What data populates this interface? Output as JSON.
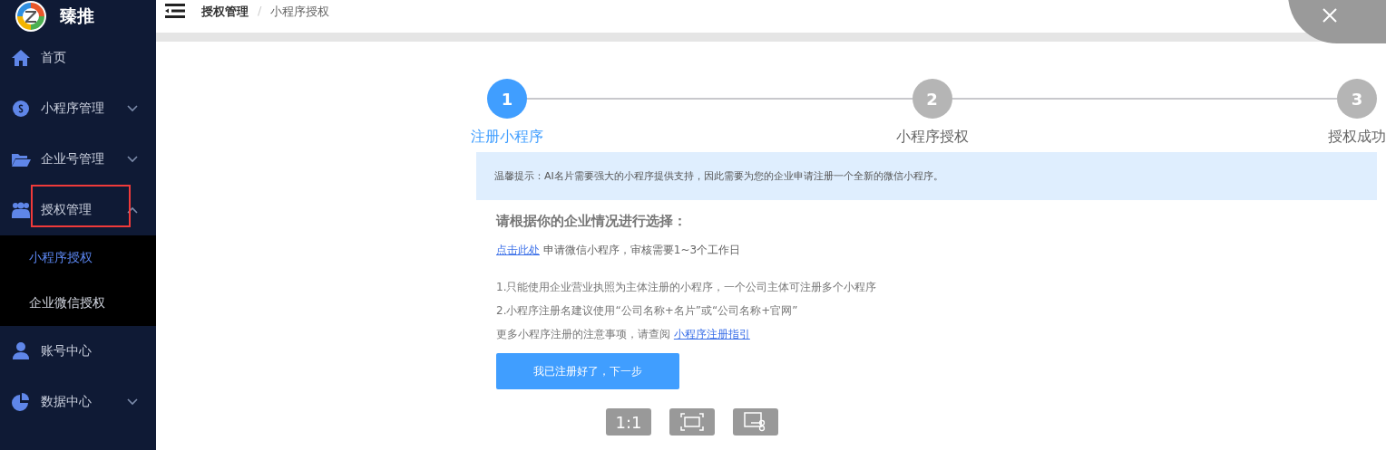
{
  "sidebar": {
    "logo_text": "臻推",
    "items": [
      {
        "label": "首页",
        "highlighted": false
      },
      {
        "label": "小程序管理",
        "expanded": false,
        "highlighted": false
      },
      {
        "label": "企业号管理",
        "expanded": false,
        "highlighted": false
      },
      {
        "label": "授权管理",
        "expanded": true,
        "highlighted": true,
        "children": [
          {
            "label": "小程序授权",
            "selected": true
          },
          {
            "label": "企业微信授权",
            "selected": false
          }
        ]
      },
      {
        "label": "账号中心",
        "highlighted": false
      },
      {
        "label": "数据中心",
        "expanded": false,
        "highlighted": false
      }
    ]
  },
  "breadcrumb": [
    "授权管理",
    "/",
    "小程序授权"
  ],
  "steps": [
    {
      "number": "1",
      "label": "注册小程序",
      "active": true
    },
    {
      "number": "2",
      "label": "小程序授权",
      "active": false
    },
    {
      "number": "3",
      "label": "授权成功",
      "active": false
    }
  ],
  "tip": "温馨提示：AI名片需要强大的小程序提供支持，因此需要为您的企业申请注册一个全新的微信小程序。",
  "heading": "请根据你的企业情况进行选择：",
  "apply_link": "点击此处",
  "apply_text": "申请微信小程序，审核需要1~3个工作日",
  "notes": [
    "1.只能使用企业营业执照为主体注册的小程序，一个公司主体可注册多个小程序",
    "2.小程序注册名建议使用“公司名称+名片”或“公司名称+官网”"
  ],
  "guide_text": "更多小程序注册的注意事项，请查阅",
  "guide_link": "小程序注册指引",
  "next_button": "我已注册好了，下一步",
  "viewer_tools": [
    {
      "kind": "text",
      "label": "1:1"
    },
    {
      "kind": "fit"
    },
    {
      "kind": "crop"
    }
  ]
}
